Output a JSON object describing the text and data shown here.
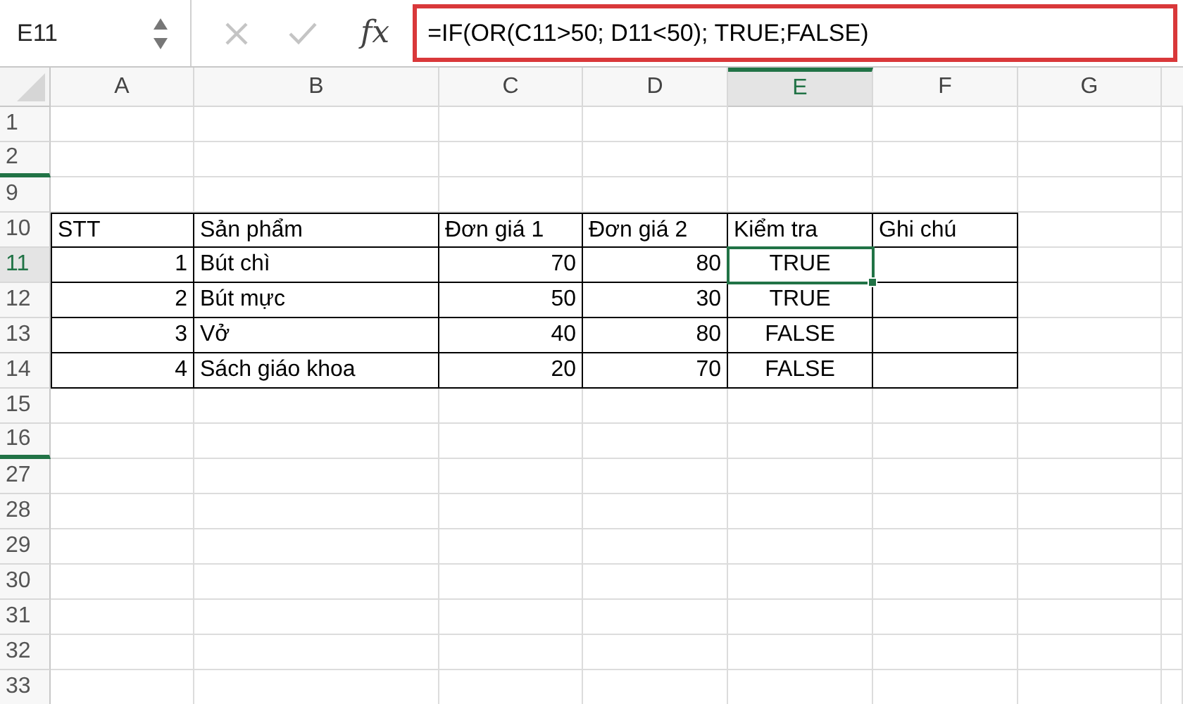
{
  "name_box": {
    "value": "E11"
  },
  "formula_bar": {
    "cancel_disabled": true,
    "enter_disabled": true,
    "function_label": "fx",
    "formula": "=IF(OR(C11>50; D11<50); TRUE;FALSE)",
    "highlighted": true
  },
  "columns": [
    {
      "label": "A",
      "selected": false
    },
    {
      "label": "B",
      "selected": false
    },
    {
      "label": "C",
      "selected": false
    },
    {
      "label": "D",
      "selected": false
    },
    {
      "label": "E",
      "selected": true
    },
    {
      "label": "F",
      "selected": false
    },
    {
      "label": "G",
      "selected": false
    }
  ],
  "rows": [
    {
      "label": "1",
      "selected": false,
      "hidden_rows_below": false
    },
    {
      "label": "2",
      "selected": false,
      "hidden_rows_below": true
    },
    {
      "label": "9",
      "selected": false,
      "hidden_rows_below": false
    },
    {
      "label": "10",
      "selected": false,
      "hidden_rows_below": false,
      "cells": [
        {
          "text": "STT",
          "kind": "text",
          "selected": false
        },
        {
          "text": "Sản phẩm",
          "kind": "text",
          "selected": false
        },
        {
          "text": "Đơn giá 1",
          "kind": "text",
          "selected": false
        },
        {
          "text": "Đơn giá 2",
          "kind": "text",
          "selected": false
        },
        {
          "text": "Kiểm tra",
          "kind": "text",
          "selected": false
        },
        {
          "text": "Ghi chú",
          "kind": "text",
          "selected": false
        }
      ]
    },
    {
      "label": "11",
      "selected": true,
      "hidden_rows_below": false,
      "cells": [
        {
          "text": "1",
          "kind": "number",
          "selected": false
        },
        {
          "text": "Bút chì",
          "kind": "text",
          "selected": false
        },
        {
          "text": "70",
          "kind": "number",
          "selected": false
        },
        {
          "text": "80",
          "kind": "number",
          "selected": false
        },
        {
          "text": "TRUE",
          "kind": "boolean",
          "selected": true
        },
        {
          "kind": "empty",
          "selected": false
        }
      ]
    },
    {
      "label": "12",
      "selected": false,
      "hidden_rows_below": false,
      "cells": [
        {
          "text": "2",
          "kind": "number",
          "selected": false
        },
        {
          "text": "Bút mực",
          "kind": "text",
          "selected": false
        },
        {
          "text": "50",
          "kind": "number",
          "selected": false
        },
        {
          "text": "30",
          "kind": "number",
          "selected": false
        },
        {
          "text": "TRUE",
          "kind": "boolean",
          "selected": false
        },
        {
          "kind": "empty",
          "selected": false
        }
      ]
    },
    {
      "label": "13",
      "selected": false,
      "hidden_rows_below": false,
      "cells": [
        {
          "text": "3",
          "kind": "number",
          "selected": false
        },
        {
          "text": "Vở",
          "kind": "text",
          "selected": false
        },
        {
          "text": "40",
          "kind": "number",
          "selected": false
        },
        {
          "text": "80",
          "kind": "number",
          "selected": false
        },
        {
          "text": "FALSE",
          "kind": "boolean",
          "selected": false
        },
        {
          "kind": "empty",
          "selected": false
        }
      ]
    },
    {
      "label": "14",
      "selected": false,
      "hidden_rows_below": false,
      "cells": [
        {
          "text": "4",
          "kind": "number",
          "selected": false
        },
        {
          "text": "Sách giáo khoa",
          "kind": "text",
          "selected": false
        },
        {
          "text": "20",
          "kind": "number",
          "selected": false
        },
        {
          "text": "70",
          "kind": "number",
          "selected": false
        },
        {
          "text": "FALSE",
          "kind": "boolean",
          "selected": false
        },
        {
          "kind": "empty",
          "selected": false
        }
      ]
    },
    {
      "label": "15",
      "selected": false,
      "hidden_rows_below": false
    },
    {
      "label": "16",
      "selected": false,
      "hidden_rows_below": true
    },
    {
      "label": "27",
      "selected": false,
      "hidden_rows_below": false
    },
    {
      "label": "28",
      "selected": false,
      "hidden_rows_below": false
    },
    {
      "label": "29",
      "selected": false,
      "hidden_rows_below": false
    },
    {
      "label": "30",
      "selected": false,
      "hidden_rows_below": false
    },
    {
      "label": "31",
      "selected": false,
      "hidden_rows_below": false
    },
    {
      "label": "32",
      "selected": false,
      "hidden_rows_below": false
    },
    {
      "label": "33",
      "selected": false,
      "hidden_rows_below": false
    }
  ]
}
